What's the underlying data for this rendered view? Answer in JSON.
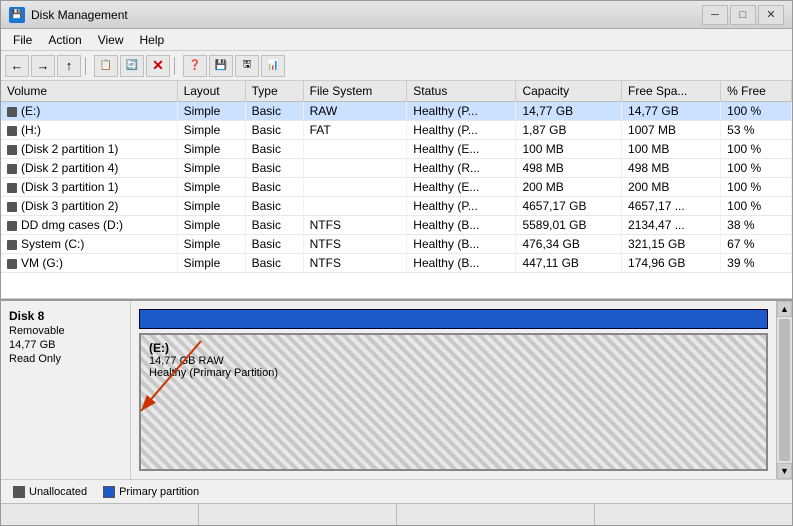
{
  "window": {
    "title": "Disk Management",
    "icon": "D"
  },
  "titlebar": {
    "minimize": "─",
    "maximize": "□",
    "close": "✕"
  },
  "menu": {
    "items": [
      "File",
      "Action",
      "View",
      "Help"
    ]
  },
  "toolbar": {
    "buttons": [
      "←",
      "→",
      "↑",
      "📋",
      "🖫",
      "✕",
      "🔑",
      "💾",
      "⚙",
      "📊"
    ]
  },
  "table": {
    "columns": [
      "Volume",
      "Layout",
      "Type",
      "File System",
      "Status",
      "Capacity",
      "Free Spa...",
      "% Free"
    ],
    "rows": [
      {
        "volume": "(E:)",
        "layout": "Simple",
        "type": "Basic",
        "fs": "RAW",
        "status": "Healthy (P...",
        "capacity": "14,77 GB",
        "free": "14,77 GB",
        "pct": "100 %"
      },
      {
        "volume": "(H:)",
        "layout": "Simple",
        "type": "Basic",
        "fs": "FAT",
        "status": "Healthy (P...",
        "capacity": "1,87 GB",
        "free": "1007 MB",
        "pct": "53 %"
      },
      {
        "volume": "(Disk 2 partition 1)",
        "layout": "Simple",
        "type": "Basic",
        "fs": "",
        "status": "Healthy (E...",
        "capacity": "100 MB",
        "free": "100 MB",
        "pct": "100 %"
      },
      {
        "volume": "(Disk 2 partition 4)",
        "layout": "Simple",
        "type": "Basic",
        "fs": "",
        "status": "Healthy (R...",
        "capacity": "498 MB",
        "free": "498 MB",
        "pct": "100 %"
      },
      {
        "volume": "(Disk 3 partition 1)",
        "layout": "Simple",
        "type": "Basic",
        "fs": "",
        "status": "Healthy (E...",
        "capacity": "200 MB",
        "free": "200 MB",
        "pct": "100 %"
      },
      {
        "volume": "(Disk 3 partition 2)",
        "layout": "Simple",
        "type": "Basic",
        "fs": "",
        "status": "Healthy (P...",
        "capacity": "4657,17 GB",
        "free": "4657,17 ...",
        "pct": "100 %"
      },
      {
        "volume": "DD dmg cases (D:)",
        "layout": "Simple",
        "type": "Basic",
        "fs": "NTFS",
        "status": "Healthy (B...",
        "capacity": "5589,01 GB",
        "free": "2134,47 ...",
        "pct": "38 %"
      },
      {
        "volume": "System (C:)",
        "layout": "Simple",
        "type": "Basic",
        "fs": "NTFS",
        "status": "Healthy (B...",
        "capacity": "476,34 GB",
        "free": "321,15 GB",
        "pct": "67 %"
      },
      {
        "volume": "VM (G:)",
        "layout": "Simple",
        "type": "Basic",
        "fs": "NTFS",
        "status": "Healthy (B...",
        "capacity": "447,11 GB",
        "free": "174,96 GB",
        "pct": "39 %"
      }
    ]
  },
  "disk8": {
    "name": "Disk 8",
    "type": "Removable",
    "size": "14,77 GB",
    "readonly": "Read Only",
    "partition_label": "(E:)",
    "partition_size": "14,77 GB RAW",
    "partition_status": "Healthy (Primary Partition)"
  },
  "legend": {
    "items": [
      {
        "label": "Unallocated",
        "color": "#555555"
      },
      {
        "label": "Primary partition",
        "color": "#1c5bc7"
      }
    ]
  },
  "statusbar": {
    "segments": [
      "",
      "",
      "",
      ""
    ]
  }
}
